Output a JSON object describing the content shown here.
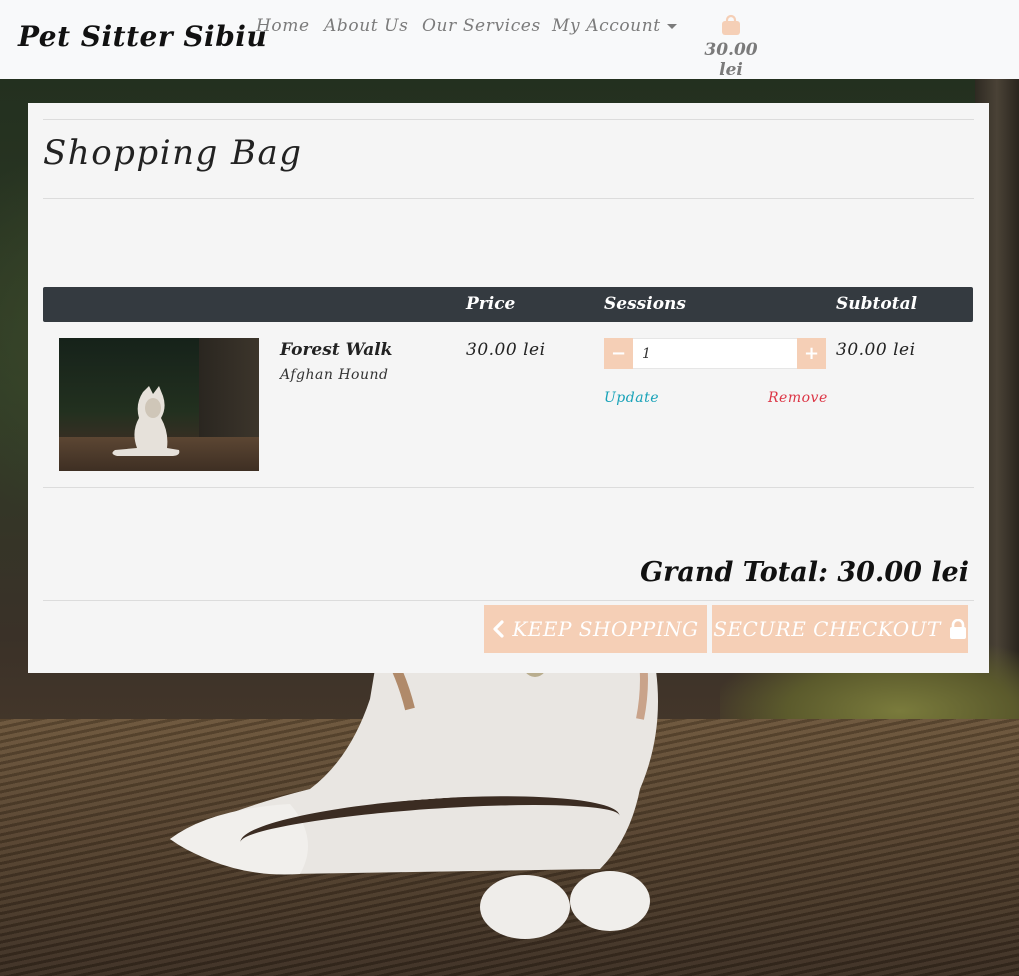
{
  "brand": "Pet Sitter Sibiu",
  "nav": {
    "home": "Home",
    "about": "About Us",
    "services": "Our Services",
    "account": "My Account",
    "bag_total": "30.00 lei"
  },
  "page": {
    "title": "Shopping Bag"
  },
  "table": {
    "headers": {
      "price": "Price",
      "sessions": "Sessions",
      "subtotal": "Subtotal"
    },
    "rows": [
      {
        "name": "Forest Walk",
        "breed": "Afghan Hound",
        "price": "30.00 lei",
        "quantity": "1",
        "minus": "−",
        "plus": "+",
        "update": "Update",
        "remove": "Remove",
        "subtotal": "30.00 lei"
      }
    ]
  },
  "grand_total": "Grand Total: 30.00 lei",
  "buttons": {
    "keep_shopping": "Keep Shopping",
    "secure_checkout": "Secure Checkout"
  },
  "colors": {
    "accent": "#f5cfb6",
    "header_dark": "#343a40",
    "update_link": "#17a2b8",
    "remove_link": "#dc3545"
  },
  "icons": {
    "bag": "shopping-bag-icon",
    "back": "chevron-left-icon",
    "lock": "lock-icon"
  }
}
